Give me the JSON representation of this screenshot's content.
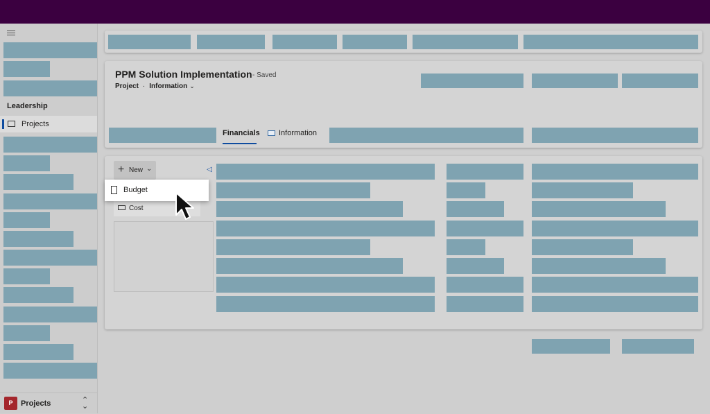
{
  "nav": {
    "section_header": "Leadership",
    "active_item": "Projects",
    "area_badge": "P",
    "area_name": "Projects",
    "area_switch_icon": "chevron-updown-icon"
  },
  "record": {
    "title": "PPM Solution Implementation",
    "status": "- Saved",
    "entity": "Project",
    "separator": "·",
    "form": "Information"
  },
  "tabs": {
    "financials": "Financials",
    "information": "Information"
  },
  "toolbar": {
    "new_label": "New"
  },
  "new_menu": {
    "items": [
      "Budget",
      "Cost"
    ]
  },
  "colors": {
    "topbar": "#3b0040",
    "placeholder": "#7fa3b1",
    "accent": "#0f4c9f",
    "badge": "#a4262c"
  }
}
